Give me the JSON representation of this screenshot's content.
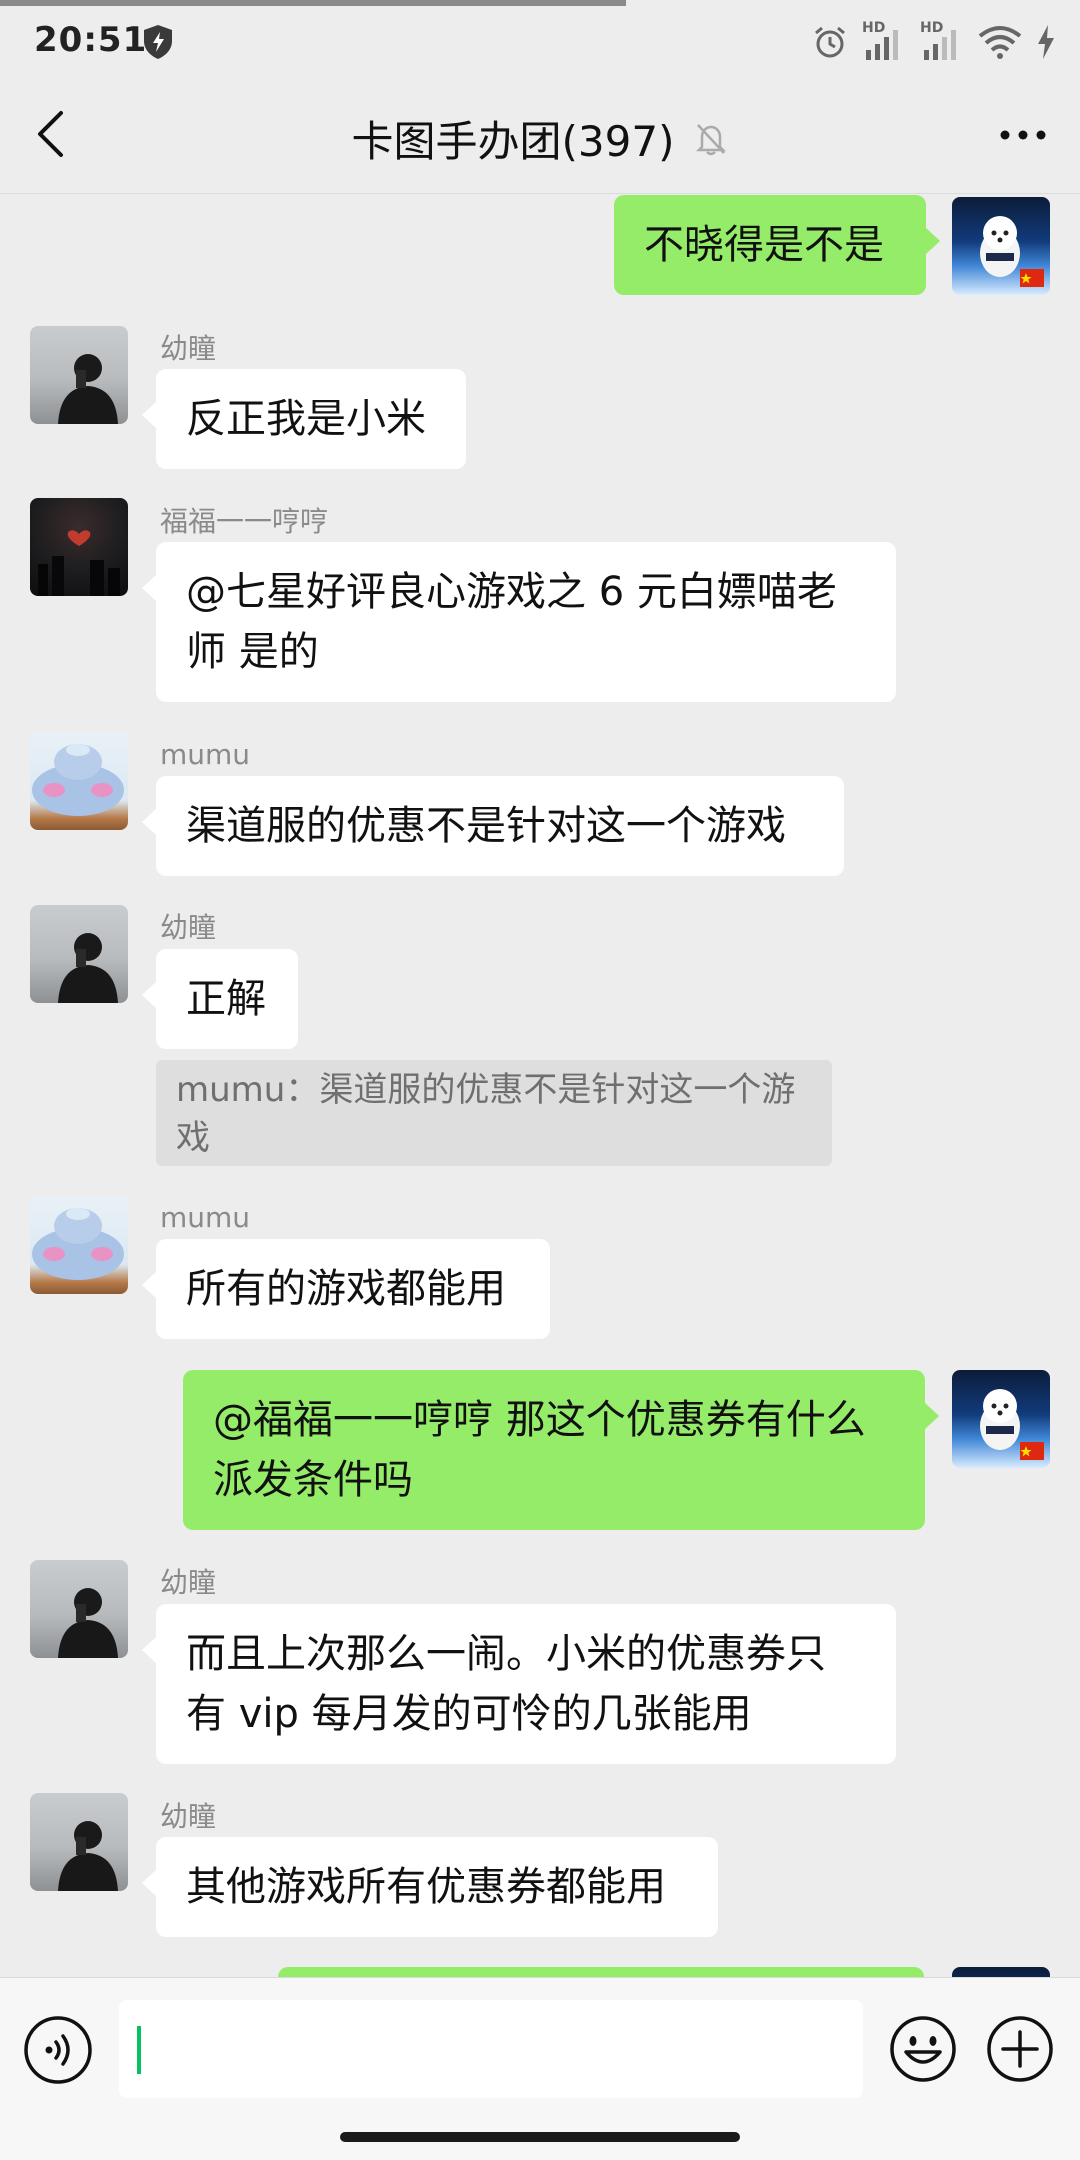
{
  "status_bar": {
    "time": "20:51",
    "network_1": "HD",
    "network_2": "HD"
  },
  "header": {
    "title": "卡图手办团(397)"
  },
  "colors": {
    "outgoing_bubble": "#95ec69",
    "incoming_bubble": "#ffffff",
    "background": "#ededed",
    "caret": "#07c160"
  },
  "messages": [
    {
      "side": "right",
      "text": "不晓得是不是"
    },
    {
      "side": "left",
      "sender": "幼瞳",
      "text": "反正我是小米"
    },
    {
      "side": "left",
      "sender": "福福一一哼哼",
      "line1": "@七星好评良心游戏之 6 元白嫖喵老",
      "line2": "师  是的"
    },
    {
      "side": "left",
      "sender": "mumu",
      "text": "渠道服的优惠不是针对这一个游戏"
    },
    {
      "side": "left",
      "sender": "幼瞳",
      "text": "正解",
      "quote_line1": "mumu：渠道服的优惠不是针对这一个游",
      "quote_line2": "戏"
    },
    {
      "side": "left",
      "sender": "mumu",
      "text": "所有的游戏都能用"
    },
    {
      "side": "right",
      "line1": "@福福一一哼哼  那这个优惠券有什么",
      "line2": "派发条件吗"
    },
    {
      "side": "left",
      "sender": "幼瞳",
      "line1": "而且上次那么一闹。小米的优惠券只",
      "line2": "有 vip 每月发的可怜的几张能用"
    },
    {
      "side": "left",
      "sender": "幼瞳",
      "text": "其他游戏所有优惠券都能用"
    }
  ],
  "input": {
    "value": ""
  },
  "icons": {
    "back": "back-arrow-icon",
    "mute": "muted-bell-icon",
    "more": "more-dots-icon",
    "voice": "voice-icon",
    "emoji": "emoji-icon",
    "plus": "plus-icon"
  }
}
